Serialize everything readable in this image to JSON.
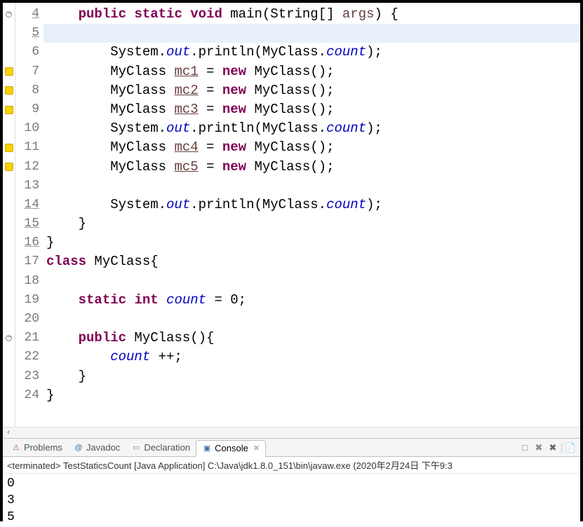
{
  "lines": [
    {
      "n": "4",
      "marker": "fold",
      "underline": true,
      "html": "    <span class='kw'>public</span> <span class='kw'>static</span> <span class='kw'>void</span> main(String[] <span class='var'>args</span>) {"
    },
    {
      "n": "5",
      "marker": "",
      "underline": true,
      "highlight": true,
      "html": "        "
    },
    {
      "n": "6",
      "marker": "",
      "underline": false,
      "html": "        System.<span class='static-f'>out</span>.println(MyClass.<span class='static-f'>count</span>);"
    },
    {
      "n": "7",
      "marker": "warn",
      "underline": false,
      "html": "        MyClass <span class='var-u'>mc1</span> = <span class='kw'>new</span> MyClass();"
    },
    {
      "n": "8",
      "marker": "warn",
      "underline": false,
      "html": "        MyClass <span class='var-u'>mc2</span> = <span class='kw'>new</span> MyClass();"
    },
    {
      "n": "9",
      "marker": "warn",
      "underline": false,
      "html": "        MyClass <span class='var-u'>mc3</span> = <span class='kw'>new</span> MyClass();"
    },
    {
      "n": "10",
      "marker": "",
      "underline": false,
      "html": "        System.<span class='static-f'>out</span>.println(MyClass.<span class='static-f'>count</span>);"
    },
    {
      "n": "11",
      "marker": "warn",
      "underline": false,
      "html": "        MyClass <span class='var-u'>mc4</span> = <span class='kw'>new</span> MyClass();"
    },
    {
      "n": "12",
      "marker": "warn",
      "underline": false,
      "html": "        MyClass <span class='var-u'>mc5</span> = <span class='kw'>new</span> MyClass();"
    },
    {
      "n": "13",
      "marker": "",
      "underline": false,
      "html": ""
    },
    {
      "n": "14",
      "marker": "",
      "underline": true,
      "html": "        System.<span class='static-f'>out</span>.println(MyClass.<span class='static-f'>count</span>);"
    },
    {
      "n": "15",
      "marker": "",
      "underline": true,
      "html": "    }"
    },
    {
      "n": "16",
      "marker": "",
      "underline": true,
      "html": "}"
    },
    {
      "n": "17",
      "marker": "",
      "underline": false,
      "html": "<span class='kw'>class</span> MyClass{"
    },
    {
      "n": "18",
      "marker": "",
      "underline": false,
      "html": ""
    },
    {
      "n": "19",
      "marker": "",
      "underline": false,
      "html": "    <span class='kw'>static</span> <span class='kw'>int</span> <span class='static-f'>count</span> = 0;"
    },
    {
      "n": "20",
      "marker": "",
      "underline": false,
      "html": ""
    },
    {
      "n": "21",
      "marker": "fold",
      "underline": false,
      "html": "    <span class='kw'>public</span> MyClass(){"
    },
    {
      "n": "22",
      "marker": "",
      "underline": false,
      "html": "        <span class='static-f'>count</span> ++;"
    },
    {
      "n": "23",
      "marker": "",
      "underline": false,
      "html": "    }"
    },
    {
      "n": "24",
      "marker": "",
      "underline": false,
      "html": "}"
    }
  ],
  "scroll_left": "‹",
  "tabs": {
    "problems": {
      "label": "Problems",
      "icon_color": "#c94f4f"
    },
    "javadoc": {
      "label": "Javadoc",
      "icon": "@",
      "icon_color": "#3a6ea5"
    },
    "declaration": {
      "label": "Declaration",
      "icon_color": "#5a9e5a"
    },
    "console": {
      "label": "Console",
      "icon_color": "#3a6ea5",
      "close": "✕"
    }
  },
  "toolbar": {
    "remove": "□",
    "close_all": "✖",
    "close": "✖",
    "pin": "📄"
  },
  "console_status": "<terminated> TestStaticsCount [Java Application] C:\\Java\\jdk1.8.0_151\\bin\\javaw.exe (2020年2月24日 下午9:3",
  "console_output": [
    "0",
    "3",
    "5"
  ]
}
